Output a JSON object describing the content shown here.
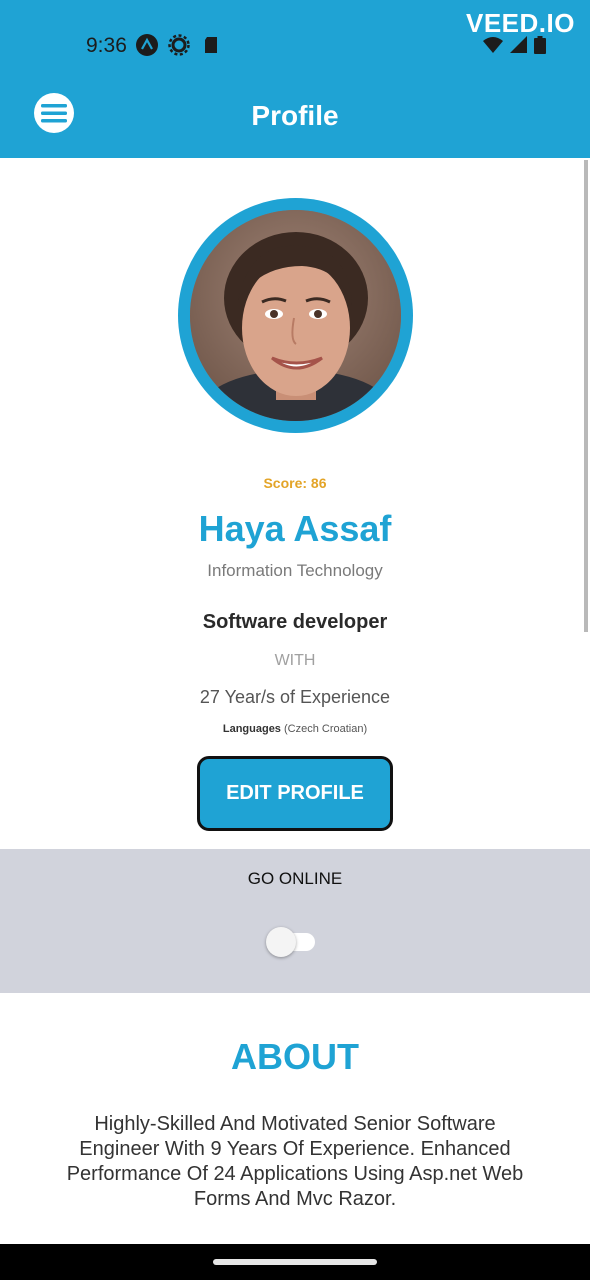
{
  "status_bar": {
    "time": "9:36",
    "left_icons": [
      "app-a-icon",
      "settings-icon",
      "sd-card-icon"
    ],
    "right_icons": [
      "wifi-icon",
      "signal-icon",
      "battery-icon"
    ],
    "watermark": "VEED.IO"
  },
  "app_bar": {
    "title": "Profile",
    "menu_icon": "menu-icon",
    "color": "#1fa3d4"
  },
  "profile": {
    "score": "Score: 86",
    "name": "Haya Assaf",
    "department": "Information Technology",
    "role": "Software developer",
    "with_label": "WITH",
    "experience": "27 Year/s of Experience",
    "languages_label": "Languages",
    "languages_value": "(Czech Croatian)",
    "edit_button": "EDIT PROFILE"
  },
  "online": {
    "label": "GO ONLINE",
    "toggle_on": false
  },
  "about": {
    "title": "ABOUT",
    "text": "Highly-Skilled And Motivated Senior Software Engineer With 9 Years Of Experience. Enhanced Performance Of 24 Applications Using Asp.net Web Forms And Mvc Razor."
  },
  "colors": {
    "accent": "#1fa3d4",
    "score": "#e3a427",
    "panel": "#d1d3dc"
  }
}
